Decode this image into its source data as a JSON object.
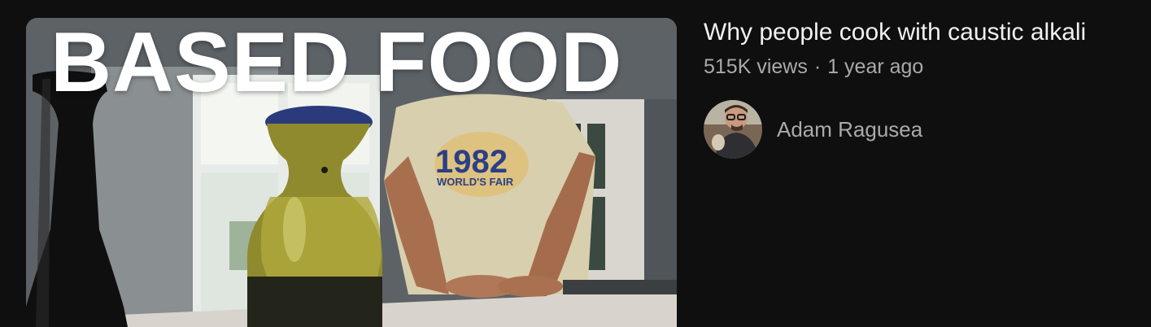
{
  "video": {
    "thumbnail_text": "BASED FOOD",
    "shirt_year": "1982",
    "shirt_line": "WORLD'S FAIR",
    "title": "Why people cook with caustic alkali",
    "views": "515K views",
    "separator": "·",
    "age": "1 year ago"
  },
  "channel": {
    "name": "Adam Ragusea",
    "avatar_icon": "channel-avatar"
  }
}
